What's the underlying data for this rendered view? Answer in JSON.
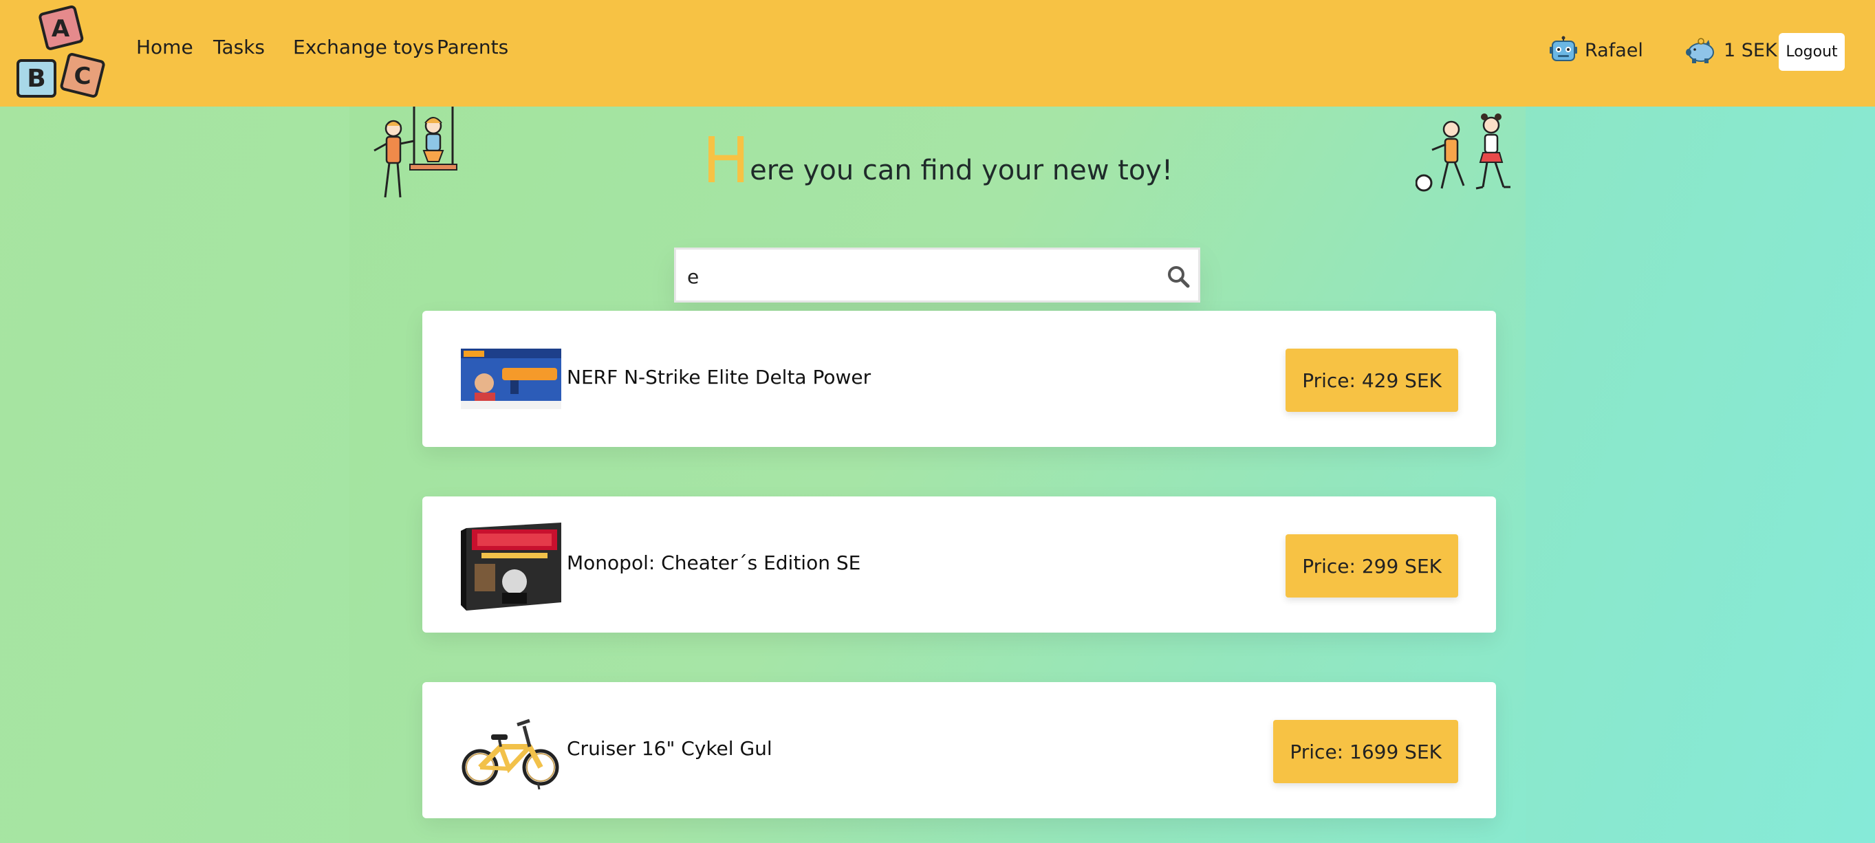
{
  "nav": {
    "links": [
      "Home",
      "Tasks",
      "Exchange toys",
      "Parents"
    ],
    "user_name": "Rafael",
    "balance": "1 SEK",
    "logout_label": "Logout"
  },
  "logo_letters": [
    "A",
    "B",
    "C"
  ],
  "heading": {
    "first_letter": "H",
    "rest": "ere you can find your new toy!"
  },
  "search": {
    "value": "e"
  },
  "products": [
    {
      "name": "NERF N-Strike Elite Delta Power",
      "price": "Price: 429 SEK"
    },
    {
      "name": "Monopol: Cheater´s Edition SE",
      "price": "Price: 299 SEK"
    },
    {
      "name": "Cruiser 16\" Cykel Gul",
      "price": "Price: 1699 SEK"
    }
  ],
  "colors": {
    "navbar": "#f7c244",
    "accent": "#f7c244",
    "card": "#ffffff"
  },
  "icons": [
    "robot-avatar-icon",
    "piggy-bank-icon",
    "search-icon"
  ]
}
